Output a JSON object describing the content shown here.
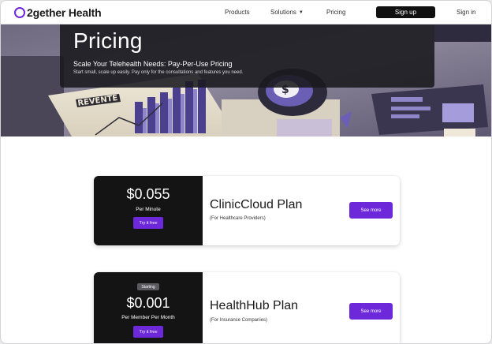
{
  "brand": {
    "name": "2gether Health",
    "accent": "#6d28d9"
  },
  "nav": {
    "products": "Products",
    "solutions": "Solutions",
    "pricing": "Pricing",
    "signup": "Sign up",
    "signin": "Sign in"
  },
  "hero": {
    "title": "Pricing",
    "subtitle": "Scale Your Telehealth Needs: Pay-Per-Use Pricing",
    "description": "Start small, scale up easily. Pay only for the consultations and features you need.",
    "image_text": "REVENTE"
  },
  "plans": [
    {
      "price": "$0.055",
      "unit": "Per Minute",
      "cta": "Try it free",
      "name": "ClinicCloud Plan",
      "audience": "(For Healthcare Providers)",
      "more": "See more"
    },
    {
      "badge": "Starting",
      "price": "$0.001",
      "unit": "Per Member Per Month",
      "cta": "Try it free",
      "name": "HealthHub Plan",
      "audience": "(For Insurance Companies)",
      "more": "See more"
    }
  ]
}
